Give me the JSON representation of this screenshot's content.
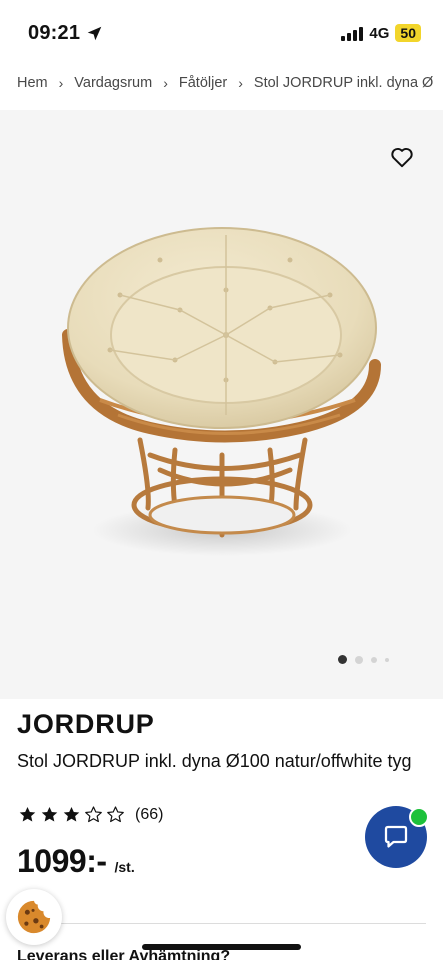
{
  "status_bar": {
    "time": "09:21",
    "network": "4G",
    "battery": "50"
  },
  "breadcrumb": [
    "Hem",
    "Vardagsrum",
    "Fåtöljer",
    "Stol JORDRUP inkl. dyna Ø"
  ],
  "breadcrumb_separator": "›",
  "gallery": {
    "image_count": 4,
    "active_index": 0
  },
  "product": {
    "brand": "JORDRUP",
    "name": "Stol JORDRUP inkl. dyna Ø100 natur/offwhite tyg",
    "rating_value": 3,
    "rating_max": 5,
    "rating_count": "(66)",
    "price": "1099:-",
    "price_unit": "/st."
  },
  "delivery_heading": "Leverans eller Avhämtning?",
  "colors": {
    "chat_button": "#1f4aa0",
    "online_badge": "#1dc13b",
    "battery": "#f2d52b"
  },
  "icons": {
    "location": "location-arrow-icon",
    "wishlist": "heart-icon",
    "chat": "chat-bubble-icon",
    "cookie": "cookie-icon"
  }
}
